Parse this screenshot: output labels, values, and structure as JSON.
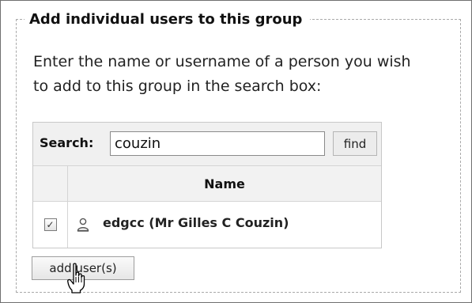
{
  "group_panel": {
    "legend": "Add individual users to this group",
    "instructions": "Enter the name or username of a person you wish to add to this group in the search box:"
  },
  "search": {
    "label": "Search:",
    "value": "couzin",
    "find_label": "find"
  },
  "results": {
    "columns": [
      "Name"
    ],
    "rows": [
      {
        "name": "edgcc (Mr Gilles C Couzin)",
        "checked": true,
        "icon": "user-icon"
      }
    ]
  },
  "actions": {
    "add_users_label": "add user(s)"
  },
  "icons": {
    "cursor": "hand-pointer-icon",
    "checkbox_mark": "✓"
  }
}
